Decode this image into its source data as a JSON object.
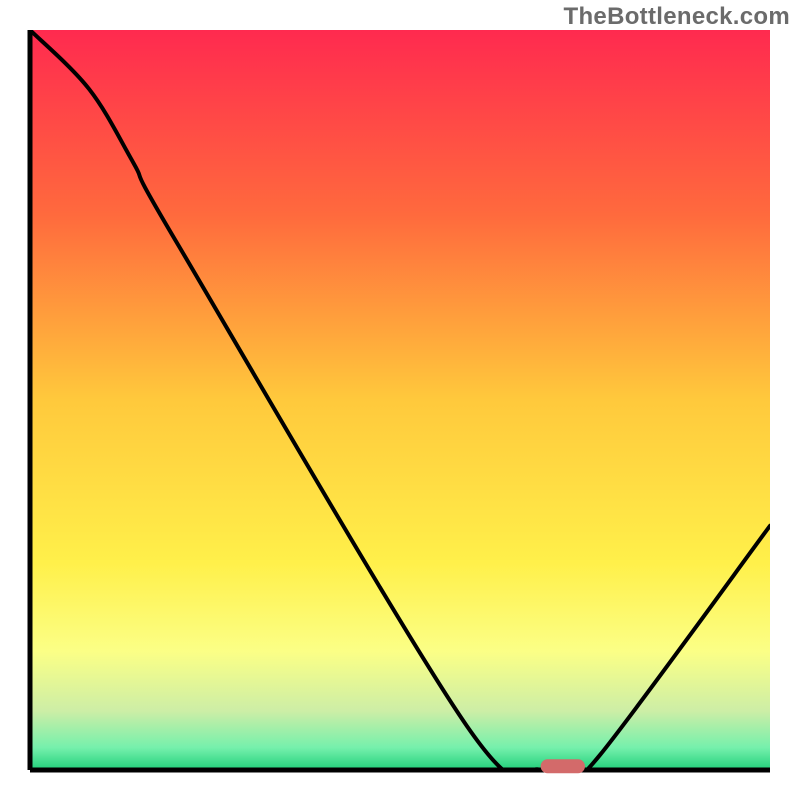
{
  "watermark": "TheBottleneck.com",
  "chart_data": {
    "type": "line",
    "title": "",
    "xlabel": "",
    "ylabel": "",
    "xlim": [
      0,
      100
    ],
    "ylim": [
      0,
      100
    ],
    "background_gradient": {
      "stops": [
        {
          "offset": 0,
          "color": "#ff2a4f"
        },
        {
          "offset": 25,
          "color": "#ff6a3d"
        },
        {
          "offset": 50,
          "color": "#ffc93c"
        },
        {
          "offset": 72,
          "color": "#fff04a"
        },
        {
          "offset": 84,
          "color": "#fbff86"
        },
        {
          "offset": 92,
          "color": "#cdeea6"
        },
        {
          "offset": 97,
          "color": "#75f0ac"
        },
        {
          "offset": 100,
          "color": "#21d07a"
        }
      ]
    },
    "series": [
      {
        "name": "bottleneck-curve",
        "x": [
          0,
          8,
          14,
          20,
          59,
          69,
          73,
          77,
          100
        ],
        "values": [
          100,
          92,
          82,
          71,
          6,
          0,
          0,
          2,
          33
        ]
      }
    ],
    "marker": {
      "name": "optimal-segment",
      "x_start": 69,
      "x_end": 75,
      "y": 0.5,
      "color": "#d36a6a"
    },
    "axes_color": "#000000",
    "grid": false,
    "legend": false
  }
}
